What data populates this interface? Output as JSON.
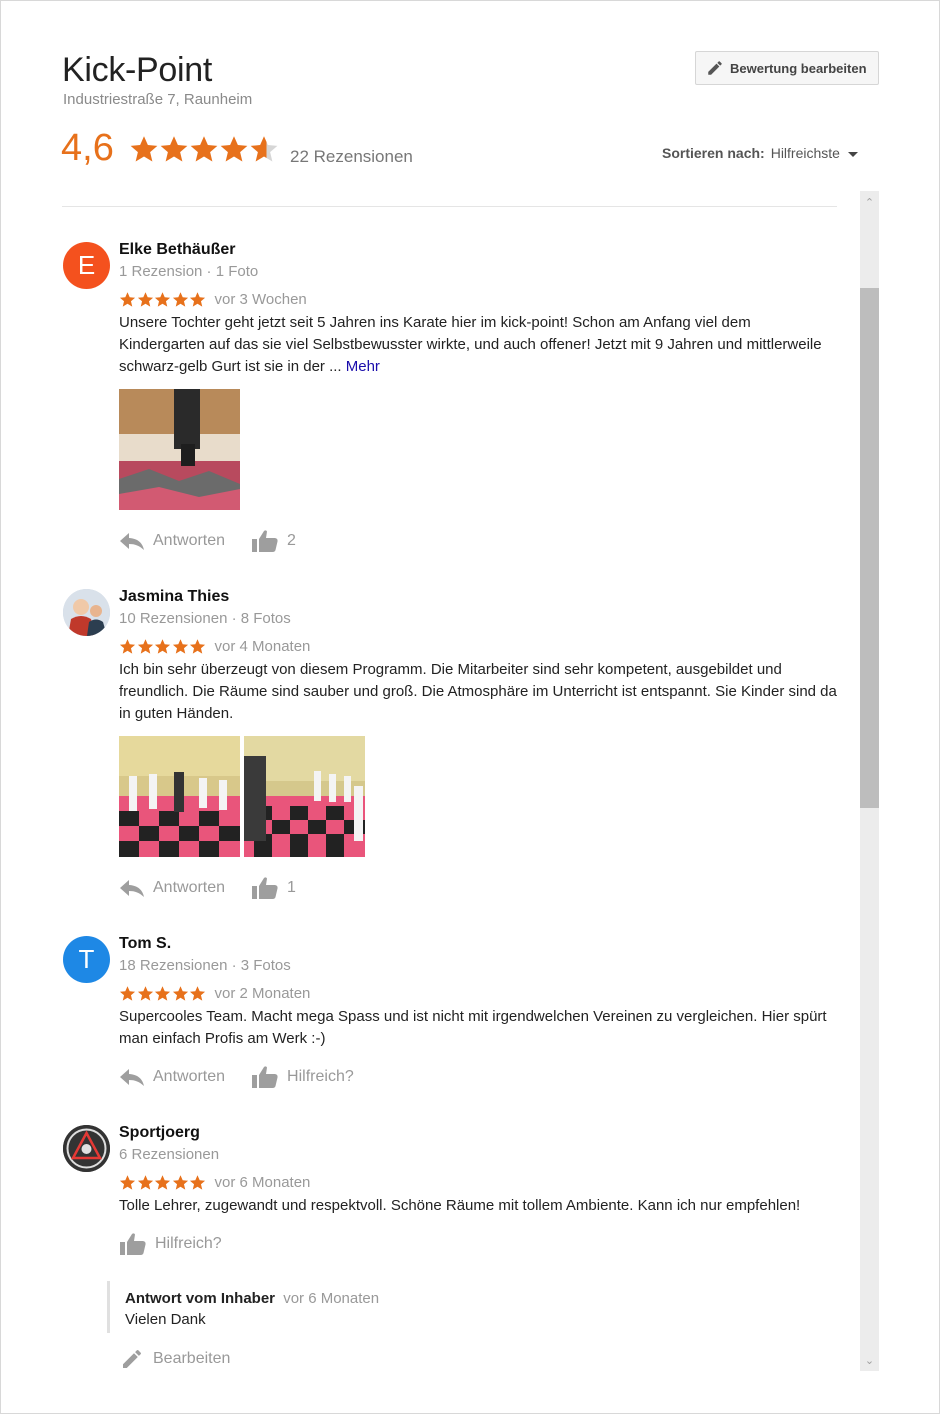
{
  "business": {
    "name": "Kick-Point",
    "address": "Industriestraße 7, Raunheim",
    "rating": "4,6",
    "rating_value": 4.6,
    "review_count": "22 Rezensionen"
  },
  "header": {
    "edit_label": "Bewertung bearbeiten",
    "sort_label": "Sortieren nach:",
    "sort_value": "Hilfreichste"
  },
  "colors": {
    "star": "#e7711b",
    "star_empty": "#d6d6d6",
    "link": "#1a0dab"
  },
  "reviews": [
    {
      "name": "Elke Bethäußer",
      "meta": "1 Rezension · 1 Foto",
      "avatar_letter": "E",
      "avatar_color": "#f4511e",
      "stars": 5,
      "date": "vor 3 Wochen",
      "text": "Unsere Tochter geht jetzt seit 5 Jahren ins Karate hier im kick-point! Schon am Anfang viel dem Kindergarten auf das sie viel Selbstbewusster wirkte, und auch offener! Jetzt mit 9 Jahren und mittlerweile schwarz-gelb Gurt ist sie in der ...",
      "more": "Mehr",
      "reply": "Antworten",
      "likes": "2"
    },
    {
      "name": "Jasmina Thies",
      "meta": "10 Rezensionen · 8 Fotos",
      "stars": 5,
      "date": "vor 4 Monaten",
      "text": "Ich bin sehr überzeugt von diesem Programm. Die Mitarbeiter sind sehr kompetent, ausgebildet und freundlich. Die Räume sind sauber und groß. Die Atmosphäre im Unterricht ist entspannt. Sie Kinder sind da in guten Händen.",
      "reply": "Antworten",
      "likes": "1"
    },
    {
      "name": "Tom S.",
      "meta": "18 Rezensionen · 3 Fotos",
      "avatar_letter": "T",
      "avatar_color": "#1e88e5",
      "stars": 5,
      "date": "vor 2 Monaten",
      "text": "Supercooles Team. Macht mega Spass und ist nicht mit irgendwelchen Vereinen zu vergleichen. Hier spürt man einfach Profis am Werk :-)",
      "reply": "Antworten",
      "likes": "Hilfreich?"
    },
    {
      "name": "Sportjoerg",
      "meta": "6 Rezensionen",
      "stars": 5,
      "date": "vor 6 Monaten",
      "text": "Tolle Lehrer, zugewandt und respektvoll. Schöne Räume mit tollem Ambiente. Kann ich nur empfehlen!",
      "likes": "Hilfreich?",
      "owner_reply": {
        "title": "Antwort vom Inhaber",
        "date": "vor 6 Monaten",
        "text": "Vielen Dank"
      },
      "edit": "Bearbeiten"
    }
  ],
  "icons": {
    "pencil": "pencil-icon",
    "star": "star-icon",
    "reply": "reply-icon",
    "thumb": "thumbs-up-icon",
    "caret": "caret-down-icon"
  }
}
